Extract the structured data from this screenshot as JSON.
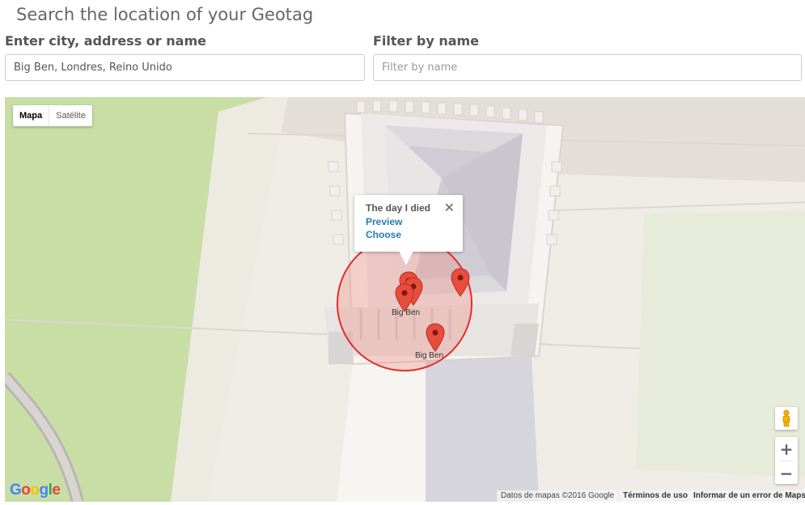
{
  "page": {
    "heading": "Search the location of your Geotag"
  },
  "search": {
    "label": "Enter city, address or name",
    "value": "Big Ben, Londres, Reino Unido"
  },
  "filter": {
    "label": "Filter by name",
    "placeholder": "Filter by name"
  },
  "map": {
    "map_type": {
      "active": "Mapa",
      "inactive": "Satélite"
    },
    "info_window": {
      "title": "The day I died",
      "preview": "Preview",
      "choose": "Choose",
      "close_icon": "close-icon"
    },
    "marker_labels": [
      "Big Ben",
      "Big Ben"
    ],
    "colors": {
      "marker": "#e94b3c",
      "circle_stroke": "#e52b2b",
      "circle_fill": "#f28b82",
      "link": "#2a7ab0",
      "park": "#c8dea5"
    },
    "footer": {
      "data": "Datos de mapas ©2016 Google",
      "terms": "Términos de uso",
      "report": "Informar de un error de Maps"
    },
    "logo": "Google",
    "icons": [
      "pegman-icon",
      "zoom-in-icon",
      "zoom-out-icon",
      "map-marker-icon"
    ]
  }
}
